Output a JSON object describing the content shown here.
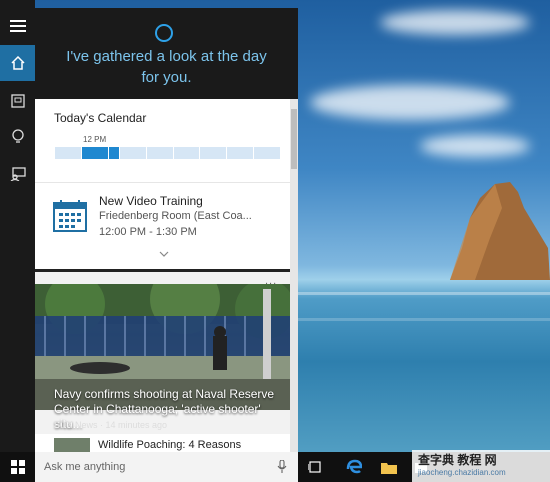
{
  "cortana": {
    "greeting_line1": "I've gathered a look at the day",
    "greeting_line2": "for you."
  },
  "calendar": {
    "title": "Today's Calendar",
    "noon_label": "12 PM"
  },
  "event": {
    "title": "New Video Training",
    "room": "Friedenberg Room (East Coa...",
    "time": "12:00 PM - 1:30 PM"
  },
  "news": {
    "more_label": "...",
    "headline": "Navy confirms shooting at Naval Reserve Center in Chattanooga; 'active shooter' situ...",
    "source_time": "FOX News · 14 minutes ago",
    "next_title": "Wildlife Poaching: 4 Reasons"
  },
  "search": {
    "placeholder": "Ask me anything"
  },
  "watermark": {
    "text": "查字典 教程 网",
    "url": "jiaocheng.chazidian.com"
  },
  "colors": {
    "accent": "#1f6fa3",
    "cortana_blue": "#2ea1e8",
    "greeting": "#7cc4ec",
    "busy_slot": "#1f88d0"
  },
  "icons": {
    "menu": "hamburger-icon",
    "home": "home-icon",
    "notebook": "notebook-icon",
    "interests": "lightbulb-icon",
    "feedback": "feedback-icon",
    "calendar": "calendar-icon",
    "mic": "microphone-icon"
  }
}
